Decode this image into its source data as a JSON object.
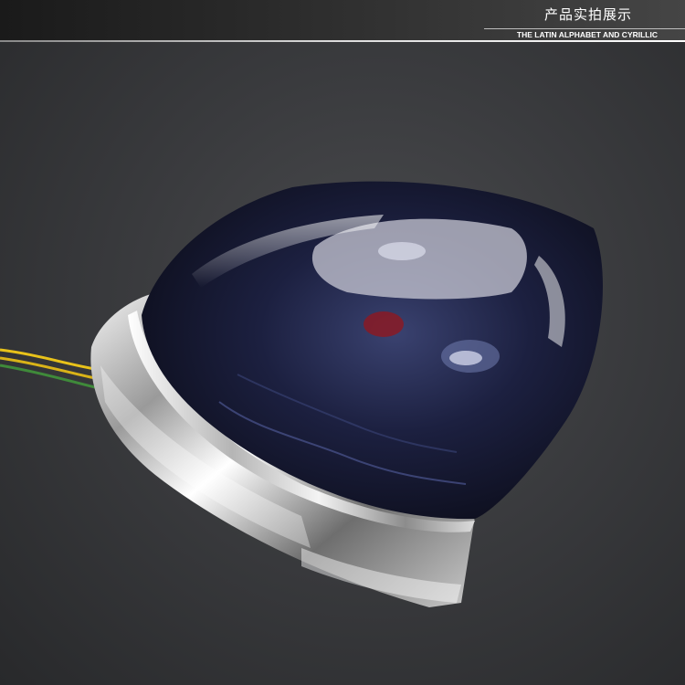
{
  "header": {
    "title": "产品实拍展示",
    "subtitle": "THE LATIN ALPHABET AND CYRILLIC"
  },
  "photo": {
    "subject": "motorcycle tail light with smoked blue lens and chrome housing",
    "colors": {
      "background": "#3a3b3e",
      "lens": "#1a1d3a",
      "chrome": "#d8d8d8",
      "wire_yellow": "#e8c21a",
      "wire_green": "#3f8a3a"
    }
  }
}
